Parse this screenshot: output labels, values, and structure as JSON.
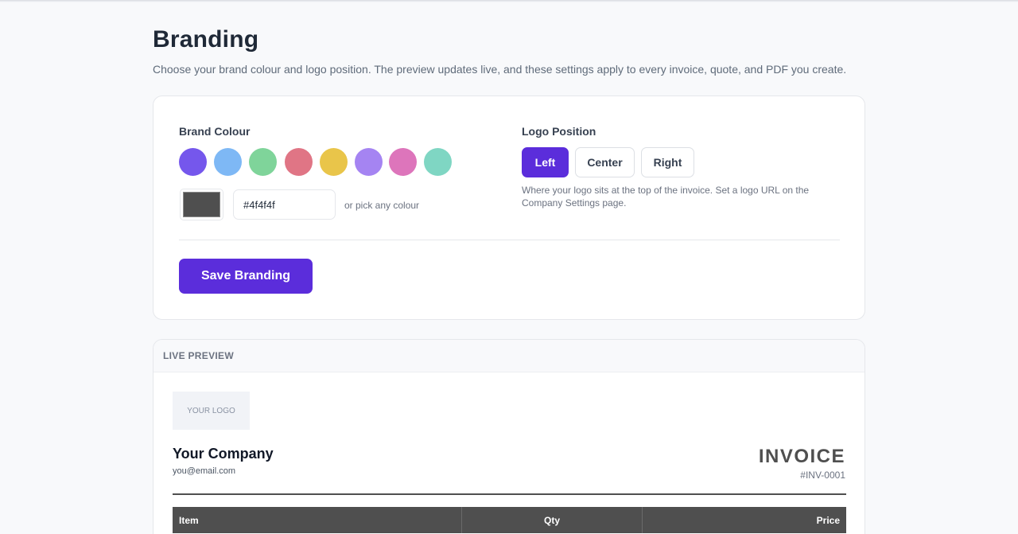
{
  "page": {
    "title": "Branding",
    "subtitle": "Choose your brand colour and logo position. The preview updates live, and these settings apply to every invoice, quote, and PDF you create."
  },
  "brand_colour": {
    "label": "Brand Colour",
    "swatches": [
      "#7557ec",
      "#7eb8f5",
      "#7fd49a",
      "#e07585",
      "#e9c54a",
      "#a584f2",
      "#dd75bb",
      "#7fd6c3"
    ],
    "current_hex": "#4f4f4f",
    "pick_hint": "or pick any colour"
  },
  "logo_position": {
    "label": "Logo Position",
    "options": [
      "Left",
      "Center",
      "Right"
    ],
    "selected": "Left",
    "hint": "Where your logo sits at the top of the invoice. Set a logo URL on the Company Settings page."
  },
  "actions": {
    "save_label": "Save Branding"
  },
  "preview": {
    "header": "LIVE PREVIEW",
    "logo_placeholder": "YOUR LOGO",
    "company_name": "Your Company",
    "company_email": "you@email.com",
    "doc_title": "INVOICE",
    "doc_number": "#INV-0001",
    "table_headers": [
      "Item",
      "Qty",
      "Price"
    ]
  },
  "colors": {
    "accent": "#5b2ddb",
    "brand_preview": "#4f4f4f"
  }
}
